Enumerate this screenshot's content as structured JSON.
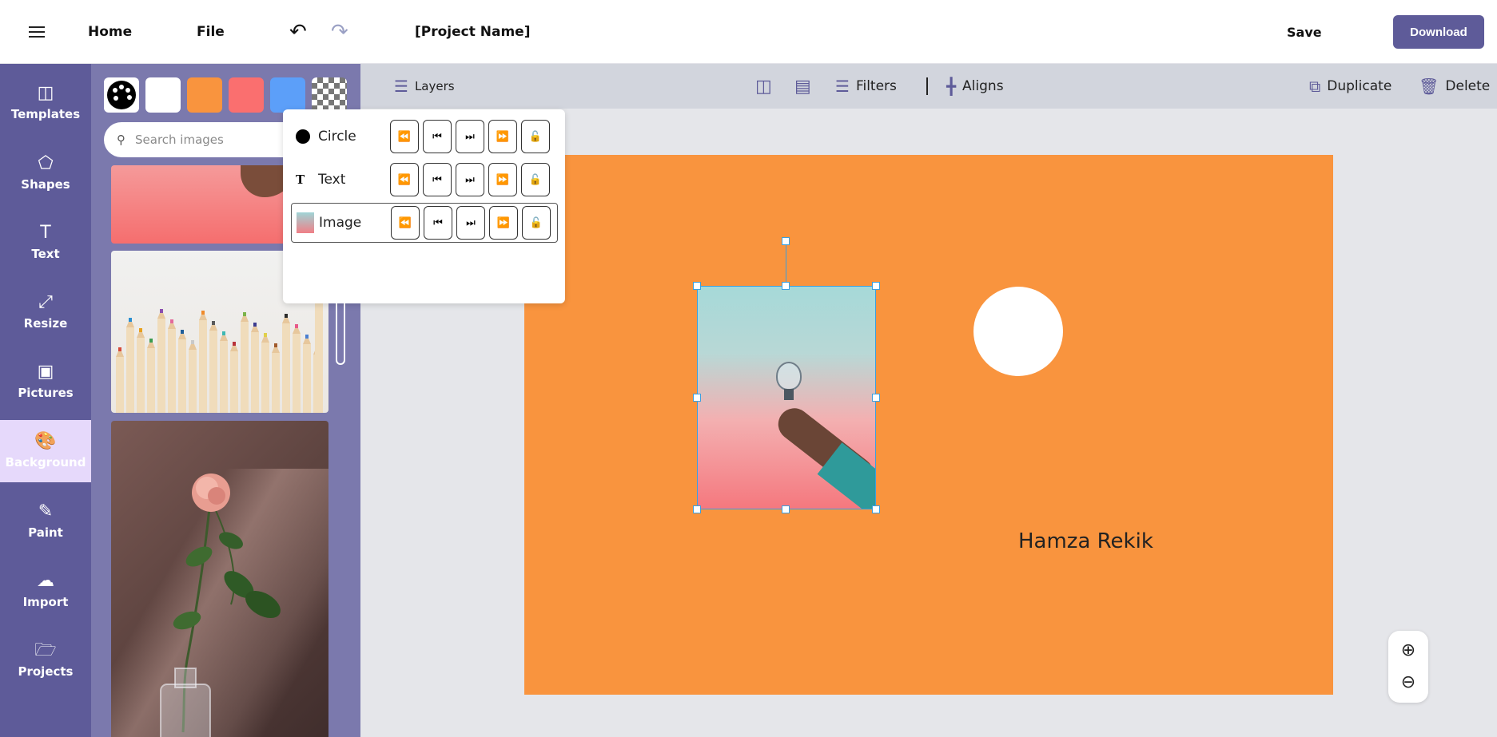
{
  "header": {
    "home": "Home",
    "file": "File",
    "project_name": "[Project Name]",
    "save": "Save",
    "download": "Download"
  },
  "leftnav": {
    "items": [
      {
        "label": "Templates",
        "icon": "templates-icon"
      },
      {
        "label": "Shapes",
        "icon": "pentagon-icon"
      },
      {
        "label": "Text",
        "icon": "text-icon"
      },
      {
        "label": "Resize",
        "icon": "resize-icon"
      },
      {
        "label": "Pictures",
        "icon": "picture-icon"
      },
      {
        "label": "Background",
        "icon": "palette-icon",
        "active": true
      },
      {
        "label": "Paint",
        "icon": "pencil-icon"
      },
      {
        "label": "Import",
        "icon": "upload-icon"
      },
      {
        "label": "Projects",
        "icon": "folder-icon"
      }
    ]
  },
  "sidepanel": {
    "swatches": [
      "palette",
      "#ffffff",
      "#f9943e",
      "#fa6f6f",
      "#5c9ff9",
      "transparent"
    ],
    "search_placeholder": "Search images"
  },
  "layers_panel": {
    "rows": [
      {
        "name": "Circle",
        "type": "circle"
      },
      {
        "name": "Text",
        "type": "text"
      },
      {
        "name": "Image",
        "type": "image",
        "selected": true
      }
    ]
  },
  "toolbar": {
    "layers": "Layers",
    "filters": "Filters",
    "aligns": "Aligns",
    "duplicate": "Duplicate",
    "delete": "Delete"
  },
  "canvas": {
    "background": "#f9943e",
    "text": "Hamza Rekik"
  },
  "colors": {
    "brand": "#5e5b99",
    "selection": "#3aa0e0"
  }
}
